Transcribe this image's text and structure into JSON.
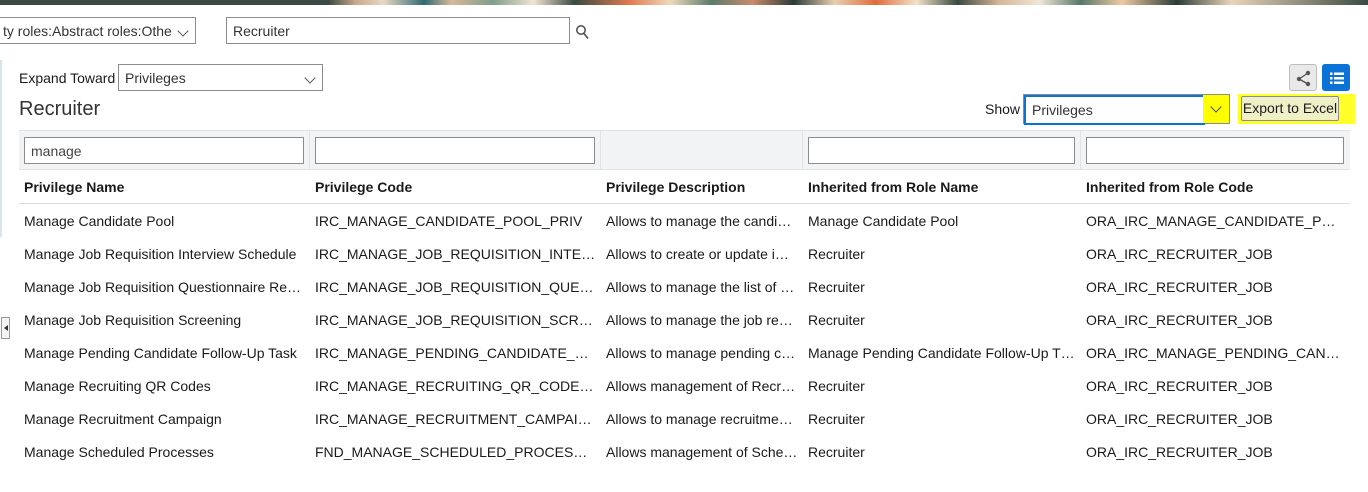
{
  "roles_filter": {
    "value": "ty roles:Abstract roles:Othe"
  },
  "search": {
    "value": "Recruiter"
  },
  "expand": {
    "label": "Expand Toward",
    "value": "Privileges"
  },
  "page_title": "Recruiter",
  "show": {
    "label": "Show",
    "value": "Privileges"
  },
  "export_label": "Export to Excel",
  "filters": {
    "privilege_name": "manage",
    "privilege_code": "",
    "inherited_role_name": "",
    "inherited_role_code": ""
  },
  "columns": [
    "Privilege Name",
    "Privilege Code",
    "Privilege Description",
    "Inherited from Role Name",
    "Inherited from Role Code"
  ],
  "rows": [
    [
      "Manage Candidate Pool",
      "IRC_MANAGE_CANDIDATE_POOL_PRIV",
      "Allows to manage the candi…",
      "Manage Candidate Pool",
      "ORA_IRC_MANAGE_CANDIDATE_PO…"
    ],
    [
      "Manage Job Requisition Interview Schedule",
      "IRC_MANAGE_JOB_REQUISITION_INTER…",
      "Allows to create or update i…",
      "Recruiter",
      "ORA_IRC_RECRUITER_JOB"
    ],
    [
      "Manage Job Requisition Questionnaire Re…",
      "IRC_MANAGE_JOB_REQUISITION_QUES…",
      "Allows to manage the list of …",
      "Recruiter",
      "ORA_IRC_RECRUITER_JOB"
    ],
    [
      "Manage Job Requisition Screening",
      "IRC_MANAGE_JOB_REQUISITION_SCRE…",
      "Allows to manage the job re…",
      "Recruiter",
      "ORA_IRC_RECRUITER_JOB"
    ],
    [
      "Manage Pending Candidate Follow-Up Task",
      "IRC_MANAGE_PENDING_CANDIDATE_F…",
      "Allows to manage pending c…",
      "Manage Pending Candidate Follow-Up T…",
      "ORA_IRC_MANAGE_PENDING_CANDI…"
    ],
    [
      "Manage Recruiting QR Codes",
      "IRC_MANAGE_RECRUITING_QR_CODES…",
      "Allows management of Recr…",
      "Recruiter",
      "ORA_IRC_RECRUITER_JOB"
    ],
    [
      "Manage Recruitment Campaign",
      "IRC_MANAGE_RECRUITMENT_CAMPAIG…",
      "Allows to manage recruitme…",
      "Recruiter",
      "ORA_IRC_RECRUITER_JOB"
    ],
    [
      "Manage Scheduled Processes",
      "FND_MANAGE_SCHEDULED_PROCESS…",
      "Allows management of Sche…",
      "Recruiter",
      "ORA_IRC_RECRUITER_JOB"
    ]
  ],
  "colors": {
    "accent": "#0b72d7",
    "highlight": "#ffff29"
  }
}
